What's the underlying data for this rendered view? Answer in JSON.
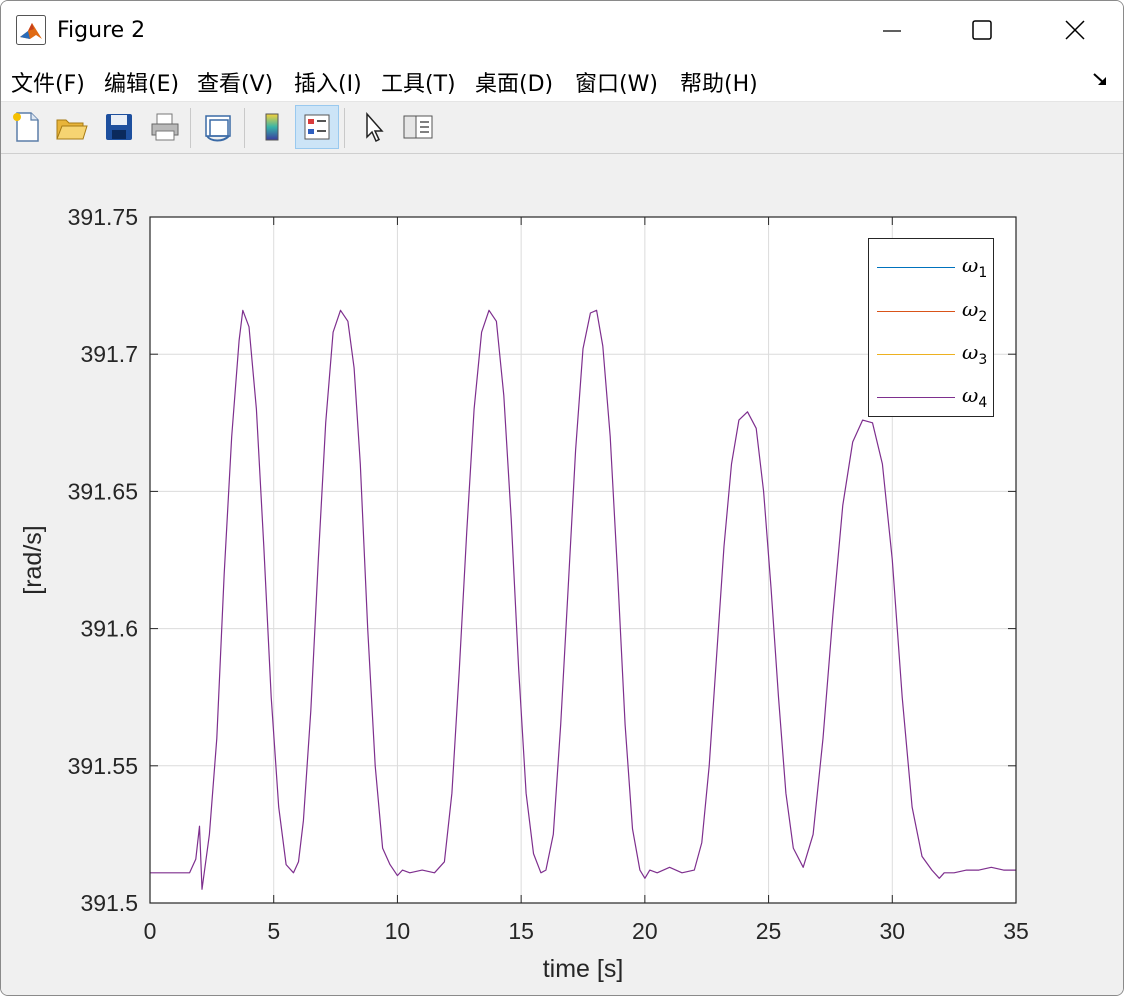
{
  "window": {
    "title": "Figure 2",
    "controls": [
      "minimize",
      "maximize",
      "close"
    ]
  },
  "menu": {
    "items": [
      "文件(F)",
      "编辑(E)",
      "查看(V)",
      "插入(I)",
      "工具(T)",
      "桌面(D)",
      "窗口(W)",
      "帮助(H)"
    ]
  },
  "toolbar": {
    "buttons": [
      {
        "name": "new-figure-icon"
      },
      {
        "name": "open-file-icon"
      },
      {
        "name": "save-icon"
      },
      {
        "name": "print-icon"
      },
      {
        "name": "link-plot-icon"
      },
      {
        "name": "colorbar-icon"
      },
      {
        "name": "legend-icon",
        "active": true
      },
      {
        "name": "edit-plot-pointer-icon"
      },
      {
        "name": "property-inspector-icon"
      }
    ]
  },
  "chart_data": {
    "type": "line",
    "xlabel": "time [s]",
    "ylabel": "[rad/s]",
    "xlim": [
      0,
      35
    ],
    "ylim": [
      391.5,
      391.75
    ],
    "xticks": [
      0,
      5,
      10,
      15,
      20,
      25,
      30,
      35
    ],
    "yticks": [
      391.5,
      391.55,
      391.6,
      391.65,
      391.7,
      391.75
    ],
    "xtick_labels": [
      "0",
      "5",
      "10",
      "15",
      "20",
      "25",
      "30",
      "35"
    ],
    "ytick_labels": [
      "391.5",
      "391.55",
      "391.6",
      "391.65",
      "391.7",
      "391.75"
    ],
    "grid": true,
    "legend_placement": "top-right",
    "legend": [
      {
        "symbol": "ω",
        "sub": "1",
        "color": "#0072BD"
      },
      {
        "symbol": "ω",
        "sub": "2",
        "color": "#D95319"
      },
      {
        "symbol": "ω",
        "sub": "3",
        "color": "#EDB120"
      },
      {
        "symbol": "ω",
        "sub": "4",
        "color": "#7E2F8E"
      }
    ],
    "series": [
      {
        "color": "#7E2F8E",
        "x": [
          0,
          1.6,
          1.85,
          2.0,
          2.1,
          2.4,
          2.7,
          3.0,
          3.3,
          3.6,
          3.75,
          4.0,
          4.3,
          4.6,
          4.9,
          5.2,
          5.5,
          5.8,
          6.0,
          6.2,
          6.5,
          6.8,
          7.1,
          7.4,
          7.7,
          8.0,
          8.25,
          8.5,
          8.8,
          9.1,
          9.4,
          9.7,
          10.0,
          10.2,
          10.5,
          11.0,
          11.5,
          11.9,
          12.2,
          12.5,
          12.8,
          13.1,
          13.4,
          13.7,
          14.0,
          14.3,
          14.6,
          14.9,
          15.2,
          15.5,
          15.8,
          16.0,
          16.3,
          16.6,
          16.9,
          17.2,
          17.5,
          17.8,
          18.05,
          18.3,
          18.6,
          18.9,
          19.2,
          19.5,
          19.8,
          20.0,
          20.2,
          20.5,
          21.0,
          21.5,
          22.0,
          22.3,
          22.6,
          22.9,
          23.2,
          23.5,
          23.8,
          24.15,
          24.5,
          24.8,
          25.1,
          25.4,
          25.7,
          26.0,
          26.4,
          26.8,
          27.2,
          27.6,
          28.0,
          28.4,
          28.8,
          29.2,
          29.6,
          30.0,
          30.4,
          30.8,
          31.2,
          31.6,
          31.9,
          32.1,
          32.5,
          33.0,
          33.5,
          34.0,
          34.5,
          35.0
        ],
        "y": [
          391.511,
          391.511,
          391.516,
          391.528,
          391.505,
          391.525,
          391.56,
          391.62,
          391.67,
          391.705,
          391.716,
          391.71,
          391.68,
          391.63,
          391.575,
          391.535,
          391.514,
          391.511,
          391.515,
          391.53,
          391.57,
          391.625,
          391.675,
          391.708,
          391.716,
          391.712,
          391.695,
          391.66,
          391.6,
          391.55,
          391.52,
          391.514,
          391.51,
          391.512,
          391.511,
          391.512,
          391.511,
          391.515,
          391.54,
          391.585,
          391.635,
          391.68,
          391.708,
          391.716,
          391.712,
          391.685,
          391.64,
          391.585,
          391.54,
          391.518,
          391.511,
          391.512,
          391.525,
          391.565,
          391.615,
          391.665,
          391.702,
          391.715,
          391.716,
          391.703,
          391.67,
          391.62,
          391.565,
          391.527,
          391.512,
          391.509,
          391.512,
          391.511,
          391.513,
          391.511,
          391.512,
          391.522,
          391.55,
          391.59,
          391.63,
          391.66,
          391.676,
          391.679,
          391.673,
          391.65,
          391.615,
          391.575,
          391.54,
          391.52,
          391.513,
          391.525,
          391.56,
          391.605,
          391.645,
          391.668,
          391.676,
          391.675,
          391.66,
          391.625,
          391.575,
          391.535,
          391.517,
          391.512,
          391.509,
          391.511,
          391.511,
          391.512,
          391.512,
          391.513,
          391.512,
          391.512
        ]
      }
    ]
  }
}
